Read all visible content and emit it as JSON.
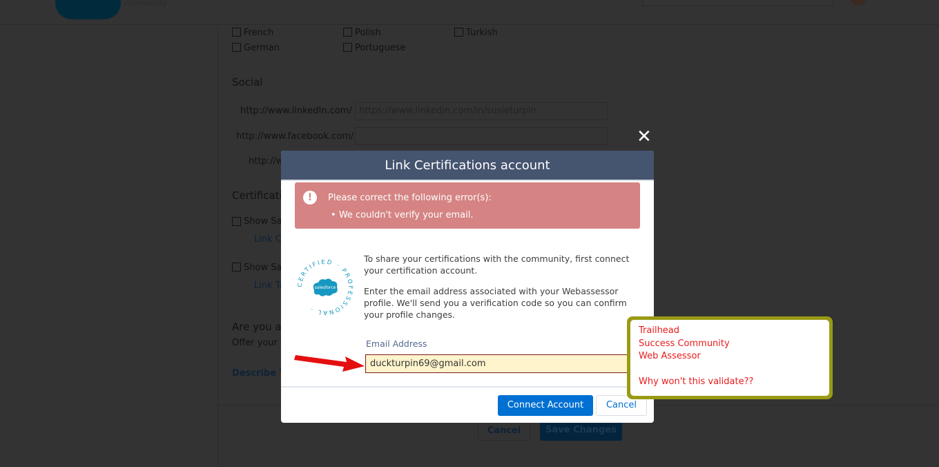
{
  "header": {
    "logo_sub": "community"
  },
  "languages": [
    "French",
    "Polish",
    "Turkish",
    "German",
    "Portuguese"
  ],
  "social": {
    "heading": "Social",
    "linkedin_label": "http://www.linkedIn.com/",
    "linkedin_value": "https://www.linkedin.com/in/susieturpin",
    "facebook_label": "http://www.facebook.com/",
    "third_label": "http://w"
  },
  "certs": {
    "heading": "Certificatio",
    "show1": "Show Sal",
    "link1": "Link Ce",
    "show2": "Show Sal",
    "link2": "Link Tr"
  },
  "expert": {
    "heading": "Are you a",
    "sub": "Offer your d",
    "link": "Describe Yo"
  },
  "page_buttons": {
    "cancel": "Cancel",
    "save": "Save Changes"
  },
  "modal": {
    "title": "Link Certifications account",
    "error_title": "Please correct the following error(s):",
    "error_item": "We couldn't verify your email.",
    "desc1": "To share your certifications with the community, first connect your certification account.",
    "desc2": "Enter the email address associated with your Webassessor profile. We'll send you a verification code so you can confirm your profile changes.",
    "badge_text": "CERTIFIED · PROFESSIONAL ·",
    "badge_logo": "salesforce",
    "email_label": "Email Address",
    "email_value": "duckturpin69@gmail.com",
    "connect": "Connect Account",
    "cancel": "Cancel"
  },
  "annotation": {
    "lines": [
      "Trailhead",
      "Success Community",
      "Web Assessor",
      "",
      "Why won't this validate??"
    ]
  }
}
